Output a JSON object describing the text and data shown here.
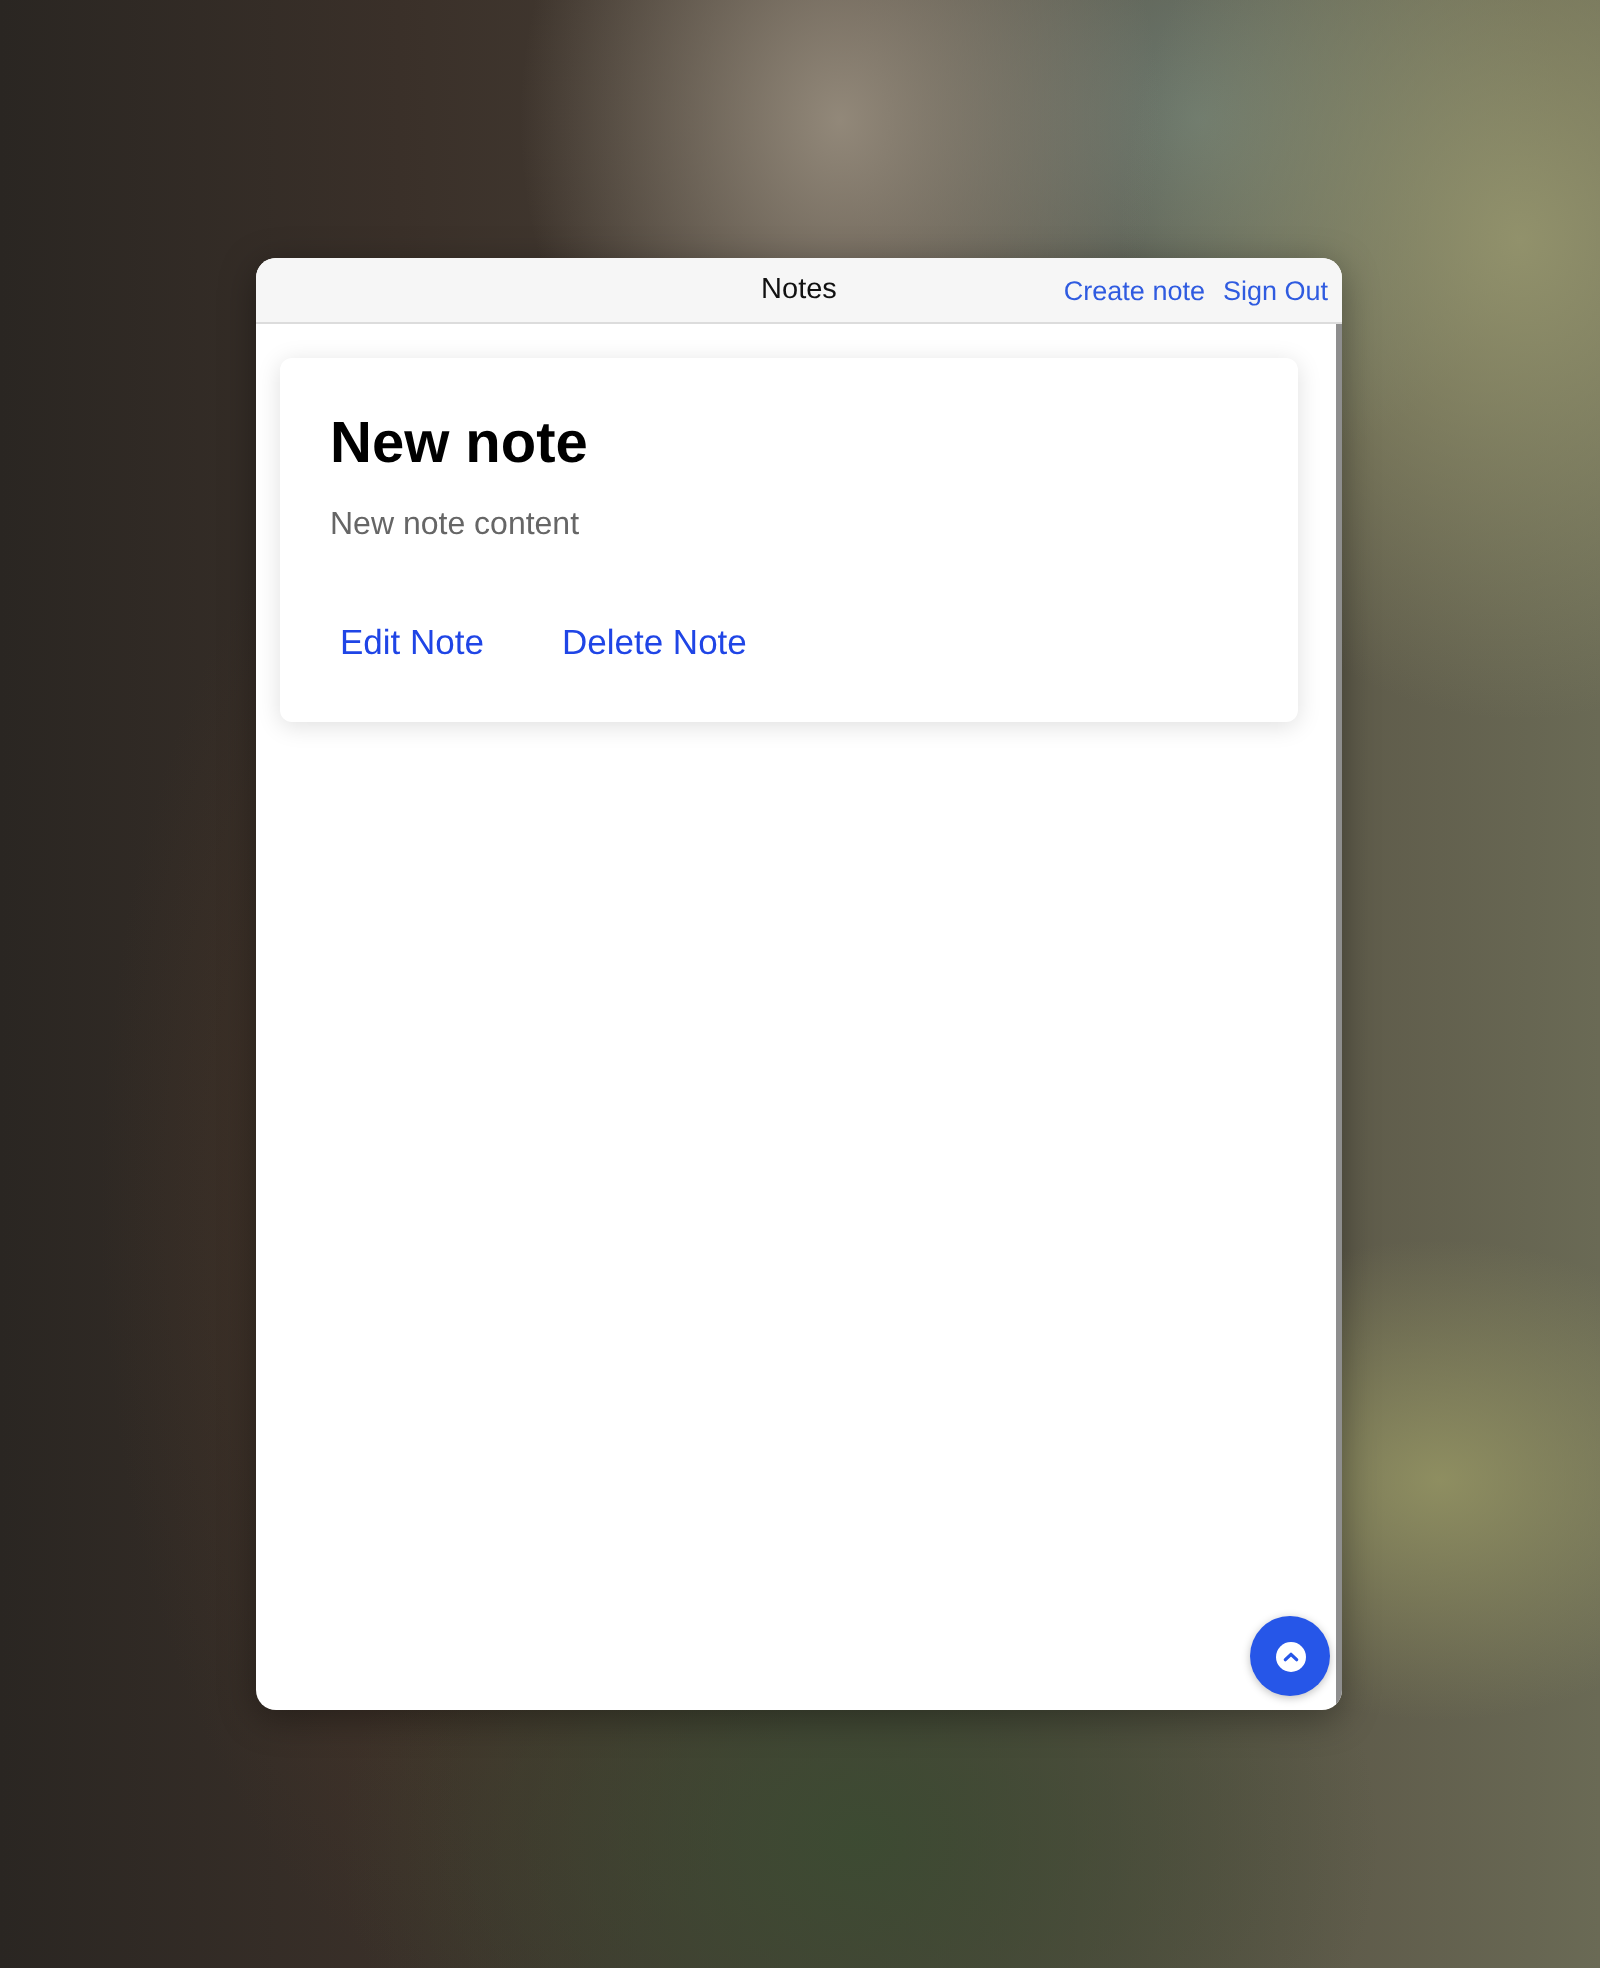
{
  "window": {
    "title": "Notes",
    "header_links": [
      "Create note",
      "Sign Out"
    ]
  },
  "notes": [
    {
      "title": "New note",
      "content": "New note content",
      "actions": [
        "Edit Note",
        "Delete Note"
      ]
    }
  ]
}
